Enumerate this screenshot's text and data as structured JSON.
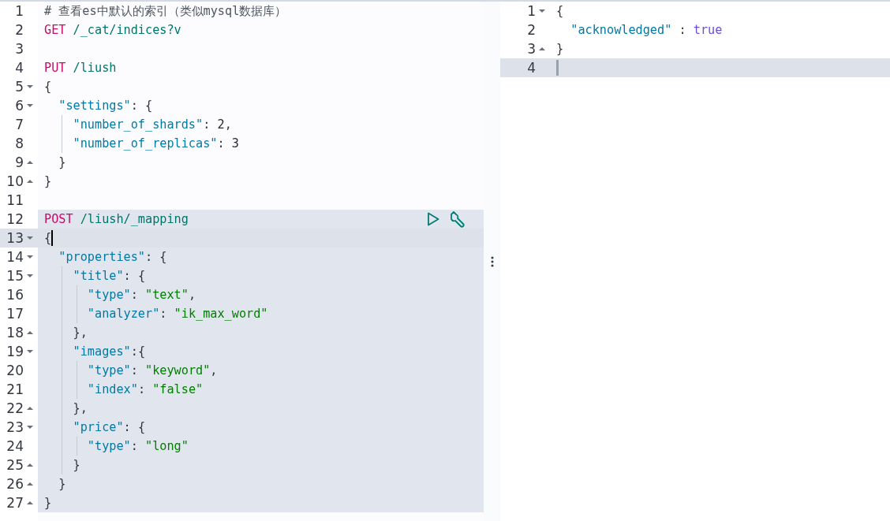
{
  "request_editor": {
    "lines": [
      {
        "number": "1",
        "kind": "plain",
        "highlighted": false,
        "active": false,
        "tokens": [
          {
            "kind": "comment",
            "text": "# 查看es中默认的索引（类似mysql数据库）"
          }
        ]
      },
      {
        "number": "2",
        "kind": "plain",
        "highlighted": false,
        "active": false,
        "tokens": [
          {
            "kind": "method",
            "text": "GET"
          },
          {
            "kind": "path",
            "text": " /_cat/indices?v"
          }
        ]
      },
      {
        "number": "3",
        "kind": "plain",
        "highlighted": false,
        "active": false
      },
      {
        "number": "4",
        "kind": "plain",
        "highlighted": false,
        "active": false,
        "tokens": [
          {
            "kind": "method",
            "text": "PUT"
          },
          {
            "kind": "path",
            "text": " /liush"
          }
        ]
      },
      {
        "number": "5",
        "kind": "fold_start",
        "highlighted": false,
        "active": false,
        "tokens": [
          {
            "kind": "punct",
            "text": "{"
          }
        ]
      },
      {
        "number": "6",
        "kind": "fold_start",
        "highlighted": false,
        "active": false,
        "tokens": [
          {
            "kind": "key",
            "text": "  \"settings\""
          },
          {
            "kind": "punct",
            "text": ": {"
          }
        ]
      },
      {
        "number": "7",
        "kind": "plain",
        "highlighted": false,
        "active": false,
        "tokens": [
          {
            "kind": "key",
            "text": "    \"number_of_shards\""
          },
          {
            "kind": "punct",
            "text": ": "
          },
          {
            "kind": "number",
            "text": "2"
          },
          {
            "kind": "punct",
            "text": ","
          }
        ]
      },
      {
        "number": "8",
        "kind": "plain",
        "highlighted": false,
        "active": false,
        "tokens": [
          {
            "kind": "key",
            "text": "    \"number_of_replicas\""
          },
          {
            "kind": "punct",
            "text": ": "
          },
          {
            "kind": "number",
            "text": "3"
          }
        ]
      },
      {
        "number": "9",
        "kind": "fold_end",
        "highlighted": false,
        "active": false,
        "tokens": [
          {
            "kind": "punct",
            "text": "  }"
          }
        ]
      },
      {
        "number": "10",
        "kind": "fold_end",
        "highlighted": false,
        "active": false,
        "tokens": [
          {
            "kind": "punct",
            "text": "}"
          }
        ]
      },
      {
        "number": "11",
        "kind": "plain",
        "highlighted": false,
        "active": false
      },
      {
        "number": "12",
        "kind": "request",
        "highlighted": true,
        "active": false,
        "tokens": [
          {
            "kind": "method",
            "text": "POST"
          },
          {
            "kind": "path",
            "text": " /liush/_mapping"
          }
        ]
      },
      {
        "number": "13",
        "kind": "fold_start",
        "highlighted": true,
        "active": true,
        "tokens": [
          {
            "kind": "punct",
            "text": "{"
          }
        ]
      },
      {
        "number": "14",
        "kind": "fold_start",
        "highlighted": true,
        "active": false,
        "tokens": [
          {
            "kind": "key",
            "text": "  \"properties\""
          },
          {
            "kind": "punct",
            "text": ": {"
          }
        ]
      },
      {
        "number": "15",
        "kind": "fold_start",
        "highlighted": true,
        "active": false,
        "tokens": [
          {
            "kind": "key",
            "text": "    \"title\""
          },
          {
            "kind": "punct",
            "text": ": {"
          }
        ]
      },
      {
        "number": "16",
        "kind": "plain",
        "highlighted": true,
        "active": false,
        "tokens": [
          {
            "kind": "key",
            "text": "      \"type\""
          },
          {
            "kind": "punct",
            "text": ": "
          },
          {
            "kind": "string",
            "text": "\"text\""
          },
          {
            "kind": "punct",
            "text": ","
          }
        ]
      },
      {
        "number": "17",
        "kind": "plain",
        "highlighted": true,
        "active": false,
        "tokens": [
          {
            "kind": "key",
            "text": "      \"analyzer\""
          },
          {
            "kind": "punct",
            "text": ": "
          },
          {
            "kind": "string",
            "text": "\"ik_max_word\""
          }
        ]
      },
      {
        "number": "18",
        "kind": "fold_end",
        "highlighted": true,
        "active": false,
        "tokens": [
          {
            "kind": "punct",
            "text": "    },"
          }
        ]
      },
      {
        "number": "19",
        "kind": "fold_start",
        "highlighted": true,
        "active": false,
        "tokens": [
          {
            "kind": "key",
            "text": "    \"images\""
          },
          {
            "kind": "punct",
            "text": ":{"
          }
        ]
      },
      {
        "number": "20",
        "kind": "plain",
        "highlighted": true,
        "active": false,
        "tokens": [
          {
            "kind": "key",
            "text": "      \"type\""
          },
          {
            "kind": "punct",
            "text": ": "
          },
          {
            "kind": "string",
            "text": "\"keyword\""
          },
          {
            "kind": "punct",
            "text": ","
          }
        ]
      },
      {
        "number": "21",
        "kind": "plain",
        "highlighted": true,
        "active": false,
        "tokens": [
          {
            "kind": "key",
            "text": "      \"index\""
          },
          {
            "kind": "punct",
            "text": ": "
          },
          {
            "kind": "string",
            "text": "\"false\""
          }
        ]
      },
      {
        "number": "22",
        "kind": "fold_end",
        "highlighted": true,
        "active": false,
        "tokens": [
          {
            "kind": "punct",
            "text": "    },"
          }
        ]
      },
      {
        "number": "23",
        "kind": "fold_start",
        "highlighted": true,
        "active": false,
        "tokens": [
          {
            "kind": "key",
            "text": "    \"price\""
          },
          {
            "kind": "punct",
            "text": ": {"
          }
        ]
      },
      {
        "number": "24",
        "kind": "plain",
        "highlighted": true,
        "active": false,
        "tokens": [
          {
            "kind": "key",
            "text": "      \"type\""
          },
          {
            "kind": "punct",
            "text": ": "
          },
          {
            "kind": "string",
            "text": "\"long\""
          }
        ]
      },
      {
        "number": "25",
        "kind": "fold_end",
        "highlighted": true,
        "active": false,
        "tokens": [
          {
            "kind": "punct",
            "text": "    }"
          }
        ]
      },
      {
        "number": "26",
        "kind": "fold_end",
        "highlighted": true,
        "active": false,
        "tokens": [
          {
            "kind": "punct",
            "text": "  }"
          }
        ]
      },
      {
        "number": "27",
        "kind": "fold_end",
        "highlighted": true,
        "active": false,
        "tokens": [
          {
            "kind": "punct",
            "text": "}"
          }
        ]
      }
    ]
  },
  "response_viewer": {
    "lines": [
      {
        "number": "1",
        "kind": "fold_start",
        "active": false,
        "tokens": [
          {
            "kind": "punct",
            "text": "{"
          }
        ]
      },
      {
        "number": "2",
        "kind": "plain",
        "active": false,
        "tokens": [
          {
            "kind": "key",
            "text": "  \"acknowledged\""
          },
          {
            "kind": "punct",
            "text": " : "
          },
          {
            "kind": "bool",
            "text": "true"
          }
        ]
      },
      {
        "number": "3",
        "kind": "fold_end",
        "active": false,
        "tokens": [
          {
            "kind": "punct",
            "text": "}"
          }
        ]
      },
      {
        "number": "4",
        "kind": "plain",
        "active": true
      }
    ]
  }
}
